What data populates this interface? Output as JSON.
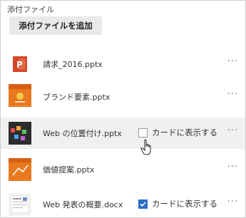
{
  "section_title": "添付ファイル",
  "add_button_label": "添付ファイルを追加",
  "more_label": "···",
  "attachments": [
    {
      "name": "請求_2016.pptx",
      "thumb": "powerpoint-icon"
    },
    {
      "name": "ブランド要素.pptx",
      "thumb": "slide-thumbnail-orange"
    },
    {
      "name": "Web の位置付け.pptx",
      "thumb": "slide-thumbnail-dark",
      "show_card_label": "カードに表示する",
      "show_card_checked": false
    },
    {
      "name": "価値提案.pptx",
      "thumb": "slide-thumbnail-orange"
    },
    {
      "name": "Web 発表の概要.docx",
      "thumb": "document-thumbnail",
      "show_card_label": "カードに表示する",
      "show_card_checked": true
    }
  ],
  "colors": {
    "checkbox_checked": "#2b6cc4",
    "powerpoint_red": "#d24726",
    "hover_row": "#f0f0f0"
  }
}
